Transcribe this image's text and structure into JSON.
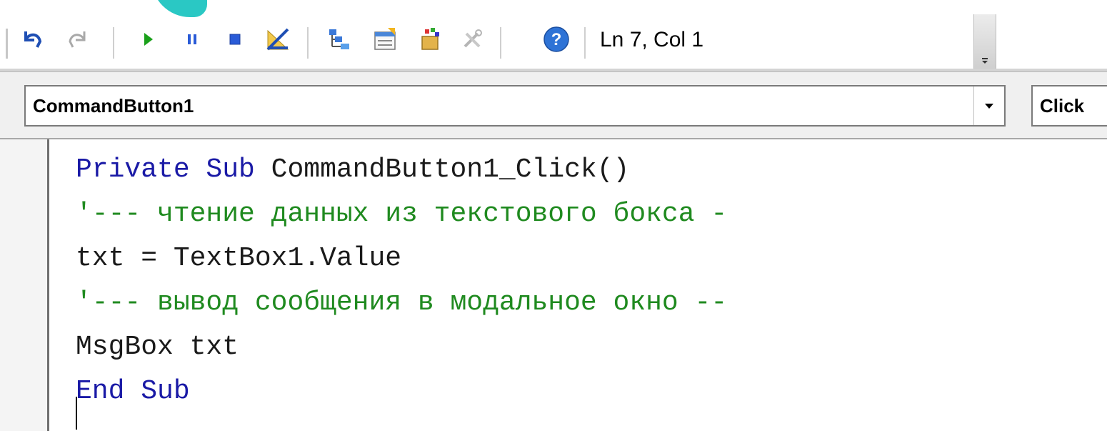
{
  "toolbar": {
    "status_text": "Ln 7, Col 1",
    "buttons": [
      {
        "name": "undo-icon"
      },
      {
        "name": "redo-icon"
      },
      {
        "name": "run-icon"
      },
      {
        "name": "break-icon"
      },
      {
        "name": "reset-icon"
      },
      {
        "name": "design-mode-icon"
      },
      {
        "name": "project-explorer-icon"
      },
      {
        "name": "properties-window-icon"
      },
      {
        "name": "object-browser-icon"
      },
      {
        "name": "toolbox-icon"
      },
      {
        "name": "help-icon"
      }
    ]
  },
  "object_combo": {
    "value": "CommandButton1"
  },
  "procedure_combo": {
    "value": "Click"
  },
  "code": {
    "lines": [
      {
        "tokens": [
          {
            "t": "Private Sub ",
            "k": "kw"
          },
          {
            "t": "CommandButton1_Click()",
            "k": "plain"
          }
        ]
      },
      {
        "tokens": [
          {
            "t": "'--- чтение данных из текстового бокса -",
            "k": "comment"
          }
        ]
      },
      {
        "tokens": [
          {
            "t": "txt = TextBox1.Value",
            "k": "plain"
          }
        ]
      },
      {
        "tokens": [
          {
            "t": "'--- вывод сообщения в модальное окно --",
            "k": "comment"
          }
        ]
      },
      {
        "tokens": [
          {
            "t": "MsgBox txt",
            "k": "plain"
          }
        ]
      },
      {
        "tokens": [
          {
            "t": "End Sub",
            "k": "kw"
          }
        ]
      }
    ]
  },
  "colors": {
    "keyword": "#1a1aa6",
    "comment": "#1f8a1f",
    "run_green": "#1aa01a",
    "accent_teal": "#28c6c2"
  }
}
